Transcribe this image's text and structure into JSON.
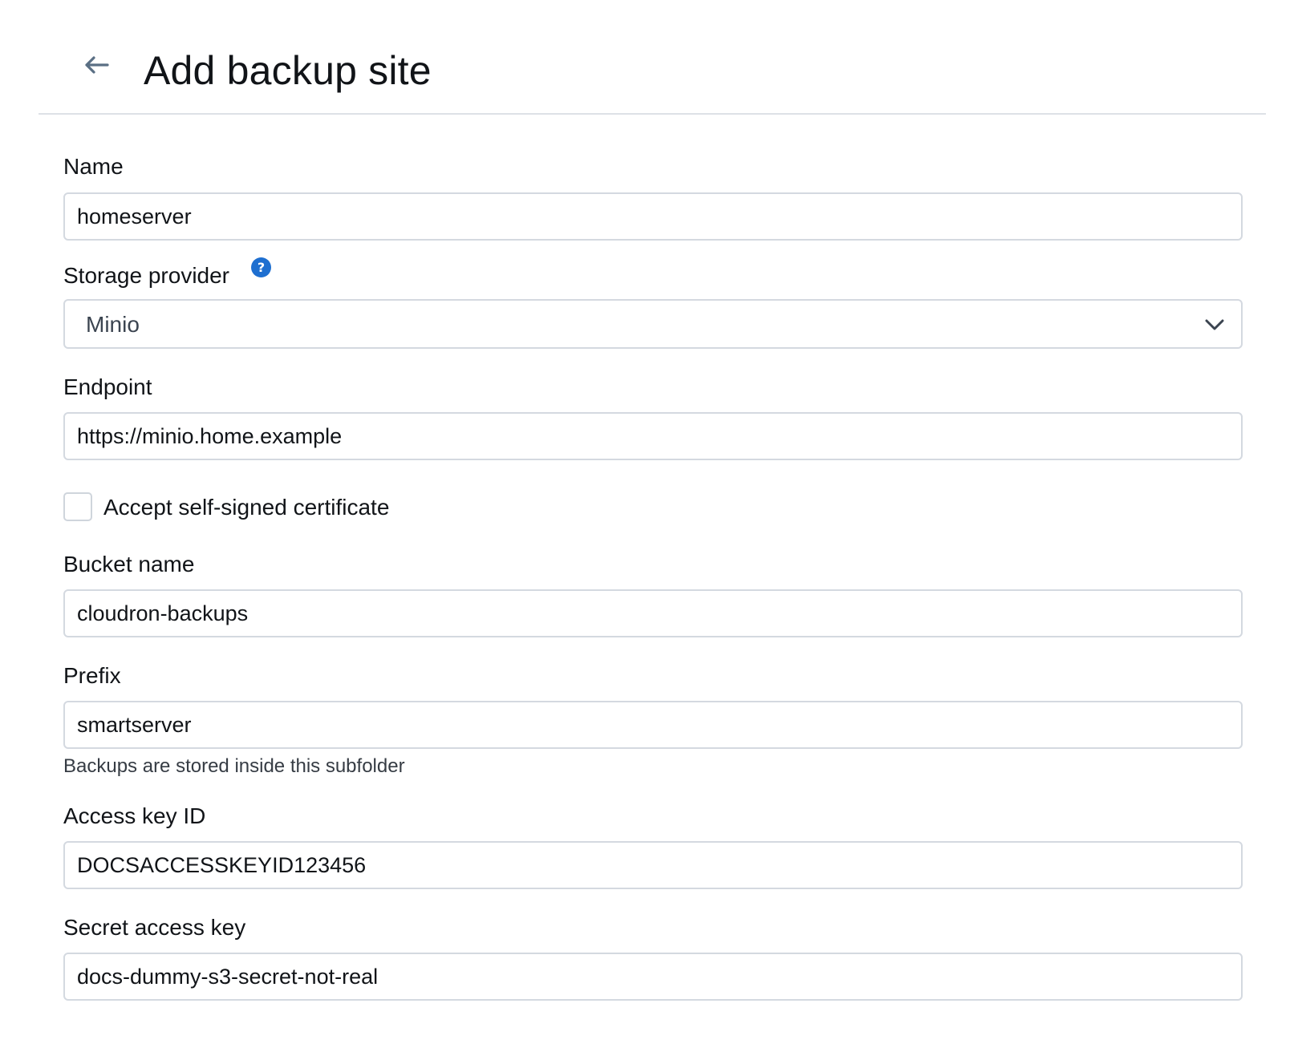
{
  "header": {
    "title": "Add backup site"
  },
  "form": {
    "name": {
      "label": "Name",
      "value": "homeserver"
    },
    "storage_provider": {
      "label": "Storage provider",
      "selected": "Minio",
      "help_glyph": "?"
    },
    "endpoint": {
      "label": "Endpoint",
      "value": "https://minio.home.example"
    },
    "accept_self_signed": {
      "label": "Accept self-signed certificate",
      "checked": false
    },
    "bucket_name": {
      "label": "Bucket name",
      "value": "cloudron-backups"
    },
    "prefix": {
      "label": "Prefix",
      "value": "smartserver",
      "hint": "Backups are stored inside this subfolder"
    },
    "access_key_id": {
      "label": "Access key ID",
      "value": "DOCSACCESSKEYID123456"
    },
    "secret_access_key": {
      "label": "Secret access key",
      "value": "docs-dummy-s3-secret-not-real"
    }
  },
  "colors": {
    "accent": "#1e6fd0",
    "border": "#d4d9e0",
    "text": "#111418",
    "muted": "#363c44",
    "back_arrow": "#5a6f84"
  },
  "icons": {
    "back": "arrow-left-icon",
    "help": "question-circle-icon",
    "dropdown": "chevron-down-icon"
  }
}
